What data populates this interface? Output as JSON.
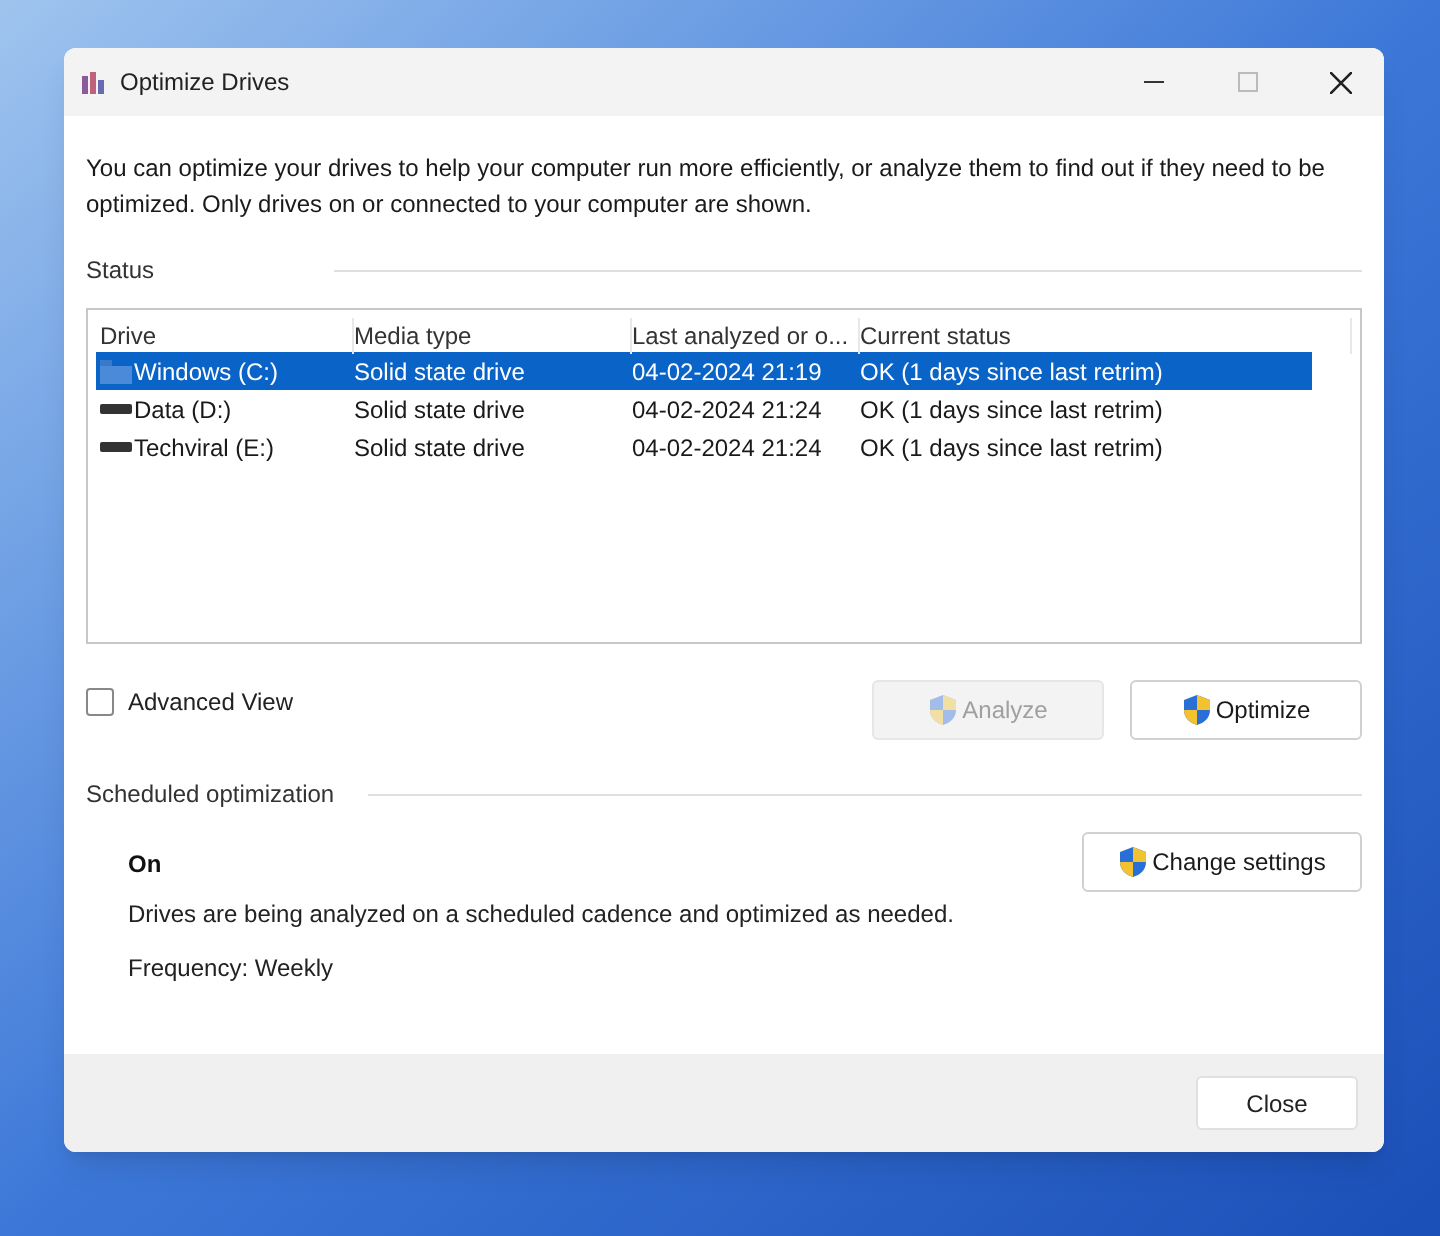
{
  "window": {
    "title": "Optimize Drives"
  },
  "intro": "You can optimize your drives to help your computer run more efficiently, or analyze them to find out if they need to be optimized. Only drives on or connected to your computer are shown.",
  "status": {
    "heading": "Status",
    "columns": [
      "Drive",
      "Media type",
      "Last analyzed or o...",
      "Current status"
    ],
    "rows": [
      {
        "kind": "system",
        "selected": true,
        "cells": [
          "Windows (C:)",
          "Solid state drive",
          "04-02-2024 21:19",
          "OK (1 days since last retrim)"
        ]
      },
      {
        "kind": "disk",
        "selected": false,
        "cells": [
          "Data (D:)",
          "Solid state drive",
          "04-02-2024 21:24",
          "OK (1 days since last retrim)"
        ]
      },
      {
        "kind": "disk",
        "selected": false,
        "cells": [
          "Techviral (E:)",
          "Solid state drive",
          "04-02-2024 21:24",
          "OK (1 days since last retrim)"
        ]
      }
    ]
  },
  "advanced_view": {
    "label": "Advanced View",
    "checked": false
  },
  "buttons": [
    {
      "label": "Analyze",
      "disabled": true
    },
    {
      "label": "Optimize",
      "disabled": false
    }
  ],
  "scheduled": {
    "heading": "Scheduled optimization",
    "state": "On",
    "description": "Drives are being analyzed on a scheduled cadence and optimized as needed.",
    "frequency": "Frequency: Weekly",
    "button": "Change settings"
  },
  "footer": {
    "button": "Close"
  }
}
